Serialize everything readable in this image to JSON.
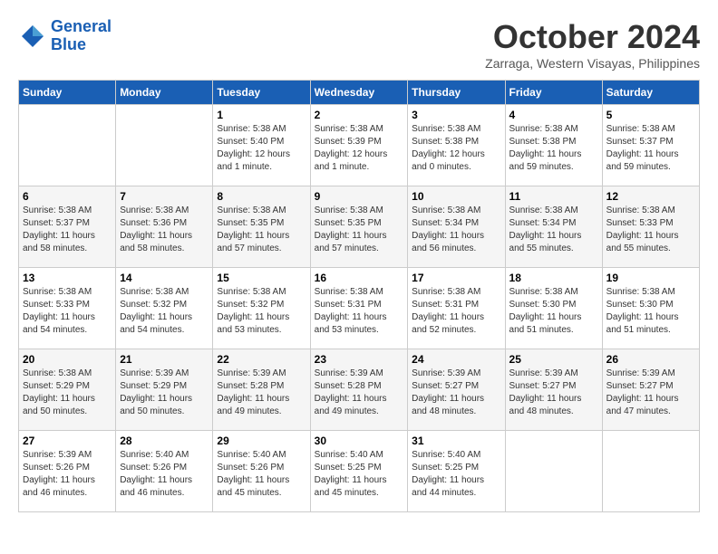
{
  "header": {
    "logo_line1": "General",
    "logo_line2": "Blue",
    "month_title": "October 2024",
    "location": "Zarraga, Western Visayas, Philippines"
  },
  "days_of_week": [
    "Sunday",
    "Monday",
    "Tuesday",
    "Wednesday",
    "Thursday",
    "Friday",
    "Saturday"
  ],
  "weeks": [
    [
      {
        "day": "",
        "info": ""
      },
      {
        "day": "",
        "info": ""
      },
      {
        "day": "1",
        "info": "Sunrise: 5:38 AM\nSunset: 5:40 PM\nDaylight: 12 hours\nand 1 minute."
      },
      {
        "day": "2",
        "info": "Sunrise: 5:38 AM\nSunset: 5:39 PM\nDaylight: 12 hours\nand 1 minute."
      },
      {
        "day": "3",
        "info": "Sunrise: 5:38 AM\nSunset: 5:38 PM\nDaylight: 12 hours\nand 0 minutes."
      },
      {
        "day": "4",
        "info": "Sunrise: 5:38 AM\nSunset: 5:38 PM\nDaylight: 11 hours\nand 59 minutes."
      },
      {
        "day": "5",
        "info": "Sunrise: 5:38 AM\nSunset: 5:37 PM\nDaylight: 11 hours\nand 59 minutes."
      }
    ],
    [
      {
        "day": "6",
        "info": "Sunrise: 5:38 AM\nSunset: 5:37 PM\nDaylight: 11 hours\nand 58 minutes."
      },
      {
        "day": "7",
        "info": "Sunrise: 5:38 AM\nSunset: 5:36 PM\nDaylight: 11 hours\nand 58 minutes."
      },
      {
        "day": "8",
        "info": "Sunrise: 5:38 AM\nSunset: 5:35 PM\nDaylight: 11 hours\nand 57 minutes."
      },
      {
        "day": "9",
        "info": "Sunrise: 5:38 AM\nSunset: 5:35 PM\nDaylight: 11 hours\nand 57 minutes."
      },
      {
        "day": "10",
        "info": "Sunrise: 5:38 AM\nSunset: 5:34 PM\nDaylight: 11 hours\nand 56 minutes."
      },
      {
        "day": "11",
        "info": "Sunrise: 5:38 AM\nSunset: 5:34 PM\nDaylight: 11 hours\nand 55 minutes."
      },
      {
        "day": "12",
        "info": "Sunrise: 5:38 AM\nSunset: 5:33 PM\nDaylight: 11 hours\nand 55 minutes."
      }
    ],
    [
      {
        "day": "13",
        "info": "Sunrise: 5:38 AM\nSunset: 5:33 PM\nDaylight: 11 hours\nand 54 minutes."
      },
      {
        "day": "14",
        "info": "Sunrise: 5:38 AM\nSunset: 5:32 PM\nDaylight: 11 hours\nand 54 minutes."
      },
      {
        "day": "15",
        "info": "Sunrise: 5:38 AM\nSunset: 5:32 PM\nDaylight: 11 hours\nand 53 minutes."
      },
      {
        "day": "16",
        "info": "Sunrise: 5:38 AM\nSunset: 5:31 PM\nDaylight: 11 hours\nand 53 minutes."
      },
      {
        "day": "17",
        "info": "Sunrise: 5:38 AM\nSunset: 5:31 PM\nDaylight: 11 hours\nand 52 minutes."
      },
      {
        "day": "18",
        "info": "Sunrise: 5:38 AM\nSunset: 5:30 PM\nDaylight: 11 hours\nand 51 minutes."
      },
      {
        "day": "19",
        "info": "Sunrise: 5:38 AM\nSunset: 5:30 PM\nDaylight: 11 hours\nand 51 minutes."
      }
    ],
    [
      {
        "day": "20",
        "info": "Sunrise: 5:38 AM\nSunset: 5:29 PM\nDaylight: 11 hours\nand 50 minutes."
      },
      {
        "day": "21",
        "info": "Sunrise: 5:39 AM\nSunset: 5:29 PM\nDaylight: 11 hours\nand 50 minutes."
      },
      {
        "day": "22",
        "info": "Sunrise: 5:39 AM\nSunset: 5:28 PM\nDaylight: 11 hours\nand 49 minutes."
      },
      {
        "day": "23",
        "info": "Sunrise: 5:39 AM\nSunset: 5:28 PM\nDaylight: 11 hours\nand 49 minutes."
      },
      {
        "day": "24",
        "info": "Sunrise: 5:39 AM\nSunset: 5:27 PM\nDaylight: 11 hours\nand 48 minutes."
      },
      {
        "day": "25",
        "info": "Sunrise: 5:39 AM\nSunset: 5:27 PM\nDaylight: 11 hours\nand 48 minutes."
      },
      {
        "day": "26",
        "info": "Sunrise: 5:39 AM\nSunset: 5:27 PM\nDaylight: 11 hours\nand 47 minutes."
      }
    ],
    [
      {
        "day": "27",
        "info": "Sunrise: 5:39 AM\nSunset: 5:26 PM\nDaylight: 11 hours\nand 46 minutes."
      },
      {
        "day": "28",
        "info": "Sunrise: 5:40 AM\nSunset: 5:26 PM\nDaylight: 11 hours\nand 46 minutes."
      },
      {
        "day": "29",
        "info": "Sunrise: 5:40 AM\nSunset: 5:26 PM\nDaylight: 11 hours\nand 45 minutes."
      },
      {
        "day": "30",
        "info": "Sunrise: 5:40 AM\nSunset: 5:25 PM\nDaylight: 11 hours\nand 45 minutes."
      },
      {
        "day": "31",
        "info": "Sunrise: 5:40 AM\nSunset: 5:25 PM\nDaylight: 11 hours\nand 44 minutes."
      },
      {
        "day": "",
        "info": ""
      },
      {
        "day": "",
        "info": ""
      }
    ]
  ]
}
